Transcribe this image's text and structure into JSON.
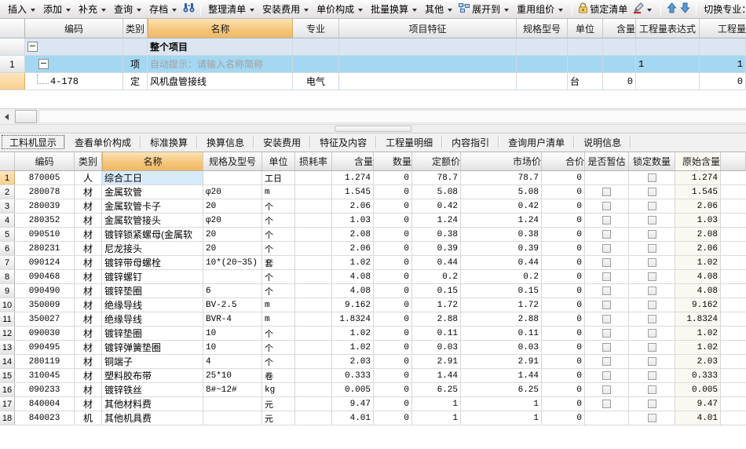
{
  "toolbar": {
    "groups": [
      {
        "items": [
          {
            "label": "插入",
            "caret": true,
            "icon": null
          },
          {
            "label": "添加",
            "caret": true,
            "icon": null
          },
          {
            "label": "补充",
            "caret": true,
            "icon": null
          },
          {
            "label": "查询",
            "caret": true,
            "icon": null
          },
          {
            "label": "存档",
            "caret": true,
            "icon": null
          },
          {
            "label": "",
            "caret": false,
            "icon": "binoculars-icon"
          }
        ]
      },
      {
        "items": [
          {
            "label": "整理清单",
            "caret": true,
            "icon": null
          },
          {
            "label": "安装费用",
            "caret": true,
            "icon": null
          },
          {
            "label": "单价构成",
            "caret": true,
            "icon": null
          },
          {
            "label": "批量换算",
            "caret": true,
            "icon": null
          },
          {
            "label": "其他",
            "caret": true,
            "icon": null
          },
          {
            "label": "展开到",
            "caret": true,
            "icon": "expand-to-icon"
          },
          {
            "label": "重用组价",
            "caret": true,
            "icon": null
          }
        ]
      },
      {
        "items": [
          {
            "label": "锁定清单",
            "caret": false,
            "icon": "lock-icon"
          },
          {
            "label": "",
            "caret": true,
            "icon": "format-painter-icon"
          }
        ]
      },
      {
        "items": [
          {
            "label": "",
            "caret": false,
            "icon": "arrow-up-icon"
          },
          {
            "label": "",
            "caret": false,
            "icon": "arrow-down-icon"
          }
        ]
      },
      {
        "items": [
          {
            "label": "切换专业：",
            "caret": false,
            "icon": null
          }
        ]
      }
    ]
  },
  "upper_table": {
    "headers": {
      "no": "",
      "code": "编码",
      "category": "类别",
      "name": "名称",
      "major": "专业",
      "feature": "项目特征",
      "spec": "规格型号",
      "unit": "单位",
      "content": "含量",
      "expr": "工程量表达式",
      "qty": "工程量"
    },
    "rows": [
      {
        "no": "",
        "code": "",
        "category": "",
        "name": "整个项目",
        "major": "",
        "feature": "",
        "spec": "",
        "unit": "",
        "content": "",
        "expr": "",
        "qty": ""
      },
      {
        "no": "1",
        "code": "",
        "category": "项",
        "name": "自动提示：请输入名称简称",
        "major": "",
        "feature": "",
        "spec": "",
        "unit": "",
        "content": "",
        "expr": "1",
        "qty": "1"
      },
      {
        "no": "",
        "code": "4-178",
        "category": "定",
        "name": "风机盘管接线",
        "major": "电气",
        "feature": "",
        "spec": "",
        "unit": "台",
        "content": "0",
        "expr": "",
        "qty": "0"
      }
    ]
  },
  "tabs": {
    "items": [
      {
        "label": "工料机显示"
      },
      {
        "label": "查看单价构成"
      },
      {
        "label": "标准换算"
      },
      {
        "label": "换算信息"
      },
      {
        "label": "安装费用"
      },
      {
        "label": "特征及内容"
      },
      {
        "label": "工程量明细"
      },
      {
        "label": "内容指引"
      },
      {
        "label": "查询用户清单"
      },
      {
        "label": "说明信息"
      }
    ],
    "active": "工料机显示"
  },
  "lower_table": {
    "headers": {
      "no": "",
      "code": "编码",
      "category": "类别",
      "name": "名称",
      "spec": "规格及型号",
      "unit": "单位",
      "loss": "损耗率",
      "content": "含量",
      "qty": "数量",
      "std_price": "定额价",
      "market_price": "市场价",
      "total": "合价",
      "provisional": "是否暂估",
      "lock_qty": "锁定数量",
      "orig_content": "原始含量",
      "tail": ""
    },
    "rows": [
      {
        "no": "1",
        "code": "870005",
        "category": "人",
        "name": "综合工日",
        "spec": "",
        "unit": "工日",
        "loss": "",
        "content": "1.274",
        "qty": "0",
        "std_price": "78.7",
        "market_price": "78.7",
        "total": "0",
        "provisional": false,
        "lock_qty": true,
        "orig_content": "1.274",
        "rowclass": "cur"
      },
      {
        "no": "2",
        "code": "280078",
        "category": "材",
        "name": "金属软管",
        "spec": "φ20",
        "unit": "m",
        "loss": "",
        "content": "1.545",
        "qty": "0",
        "std_price": "5.08",
        "market_price": "5.08",
        "total": "0",
        "provisional": true,
        "lock_qty": true,
        "orig_content": "1.545",
        "rowclass": ""
      },
      {
        "no": "3",
        "code": "280039",
        "category": "材",
        "name": "金属软管卡子",
        "spec": "20",
        "unit": "个",
        "loss": "",
        "content": "2.06",
        "qty": "0",
        "std_price": "0.42",
        "market_price": "0.42",
        "total": "0",
        "provisional": true,
        "lock_qty": true,
        "orig_content": "2.06",
        "rowclass": ""
      },
      {
        "no": "4",
        "code": "280352",
        "category": "材",
        "name": "金属软管接头",
        "spec": "φ20",
        "unit": "个",
        "loss": "",
        "content": "1.03",
        "qty": "0",
        "std_price": "1.24",
        "market_price": "1.24",
        "total": "0",
        "provisional": true,
        "lock_qty": true,
        "orig_content": "1.03",
        "rowclass": ""
      },
      {
        "no": "5",
        "code": "090510",
        "category": "材",
        "name": "镀锌锁紧螺母(金属软",
        "spec": "20",
        "unit": "个",
        "loss": "",
        "content": "2.08",
        "qty": "0",
        "std_price": "0.38",
        "market_price": "0.38",
        "total": "0",
        "provisional": true,
        "lock_qty": true,
        "orig_content": "2.08",
        "rowclass": ""
      },
      {
        "no": "6",
        "code": "280231",
        "category": "材",
        "name": "尼龙接头",
        "spec": "20",
        "unit": "个",
        "loss": "",
        "content": "2.06",
        "qty": "0",
        "std_price": "0.39",
        "market_price": "0.39",
        "total": "0",
        "provisional": true,
        "lock_qty": true,
        "orig_content": "2.06",
        "rowclass": ""
      },
      {
        "no": "7",
        "code": "090124",
        "category": "材",
        "name": "镀锌带母螺栓",
        "spec": "10*(20~35)",
        "unit": "套",
        "loss": "",
        "content": "1.02",
        "qty": "0",
        "std_price": "0.44",
        "market_price": "0.44",
        "total": "0",
        "provisional": true,
        "lock_qty": true,
        "orig_content": "1.02",
        "rowclass": ""
      },
      {
        "no": "8",
        "code": "090468",
        "category": "材",
        "name": "镀锌螺钉",
        "spec": "",
        "unit": "个",
        "loss": "",
        "content": "4.08",
        "qty": "0",
        "std_price": "0.2",
        "market_price": "0.2",
        "total": "0",
        "provisional": true,
        "lock_qty": true,
        "orig_content": "4.08",
        "rowclass": ""
      },
      {
        "no": "9",
        "code": "090490",
        "category": "材",
        "name": "镀锌垫圈",
        "spec": "6",
        "unit": "个",
        "loss": "",
        "content": "4.08",
        "qty": "0",
        "std_price": "0.15",
        "market_price": "0.15",
        "total": "0",
        "provisional": true,
        "lock_qty": true,
        "orig_content": "4.08",
        "rowclass": ""
      },
      {
        "no": "10",
        "code": "350009",
        "category": "材",
        "name": "绝缘导线",
        "spec": "BV-2.5",
        "unit": "m",
        "loss": "",
        "content": "9.162",
        "qty": "0",
        "std_price": "1.72",
        "market_price": "1.72",
        "total": "0",
        "provisional": true,
        "lock_qty": true,
        "orig_content": "9.162",
        "rowclass": ""
      },
      {
        "no": "11",
        "code": "350027",
        "category": "材",
        "name": "绝缘导线",
        "spec": "BVR-4",
        "unit": "m",
        "loss": "",
        "content": "1.8324",
        "qty": "0",
        "std_price": "2.88",
        "market_price": "2.88",
        "total": "0",
        "provisional": true,
        "lock_qty": true,
        "orig_content": "1.8324",
        "rowclass": ""
      },
      {
        "no": "12",
        "code": "090030",
        "category": "材",
        "name": "镀锌垫圈",
        "spec": "10",
        "unit": "个",
        "loss": "",
        "content": "1.02",
        "qty": "0",
        "std_price": "0.11",
        "market_price": "0.11",
        "total": "0",
        "provisional": true,
        "lock_qty": true,
        "orig_content": "1.02",
        "rowclass": ""
      },
      {
        "no": "13",
        "code": "090495",
        "category": "材",
        "name": "镀锌弹簧垫圈",
        "spec": "10",
        "unit": "个",
        "loss": "",
        "content": "1.02",
        "qty": "0",
        "std_price": "0.03",
        "market_price": "0.03",
        "total": "0",
        "provisional": true,
        "lock_qty": true,
        "orig_content": "1.02",
        "rowclass": ""
      },
      {
        "no": "14",
        "code": "280119",
        "category": "材",
        "name": "铜端子",
        "spec": "4",
        "unit": "个",
        "loss": "",
        "content": "2.03",
        "qty": "0",
        "std_price": "2.91",
        "market_price": "2.91",
        "total": "0",
        "provisional": true,
        "lock_qty": true,
        "orig_content": "2.03",
        "rowclass": ""
      },
      {
        "no": "15",
        "code": "310045",
        "category": "材",
        "name": "塑料胶布带",
        "spec": "25*10",
        "unit": "卷",
        "loss": "",
        "content": "0.333",
        "qty": "0",
        "std_price": "1.44",
        "market_price": "1.44",
        "total": "0",
        "provisional": true,
        "lock_qty": true,
        "orig_content": "0.333",
        "rowclass": ""
      },
      {
        "no": "16",
        "code": "090233",
        "category": "材",
        "name": "镀锌铁丝",
        "spec": "8#~12#",
        "unit": "kg",
        "loss": "",
        "content": "0.005",
        "qty": "0",
        "std_price": "6.25",
        "market_price": "6.25",
        "total": "0",
        "provisional": true,
        "lock_qty": true,
        "orig_content": "0.005",
        "rowclass": ""
      },
      {
        "no": "17",
        "code": "840004",
        "category": "材",
        "name": "其他材料费",
        "spec": "",
        "unit": "元",
        "loss": "",
        "content": "9.47",
        "qty": "0",
        "std_price": "1",
        "market_price": "1",
        "total": "0",
        "provisional": true,
        "lock_qty": true,
        "orig_content": "9.47",
        "rowclass": ""
      },
      {
        "no": "18",
        "code": "840023",
        "category": "机",
        "name": "其他机具费",
        "spec": "",
        "unit": "元",
        "loss": "",
        "content": "4.01",
        "qty": "0",
        "std_price": "1",
        "market_price": "1",
        "total": "0",
        "provisional": false,
        "lock_qty": true,
        "orig_content": "4.01",
        "rowclass": ""
      }
    ]
  }
}
